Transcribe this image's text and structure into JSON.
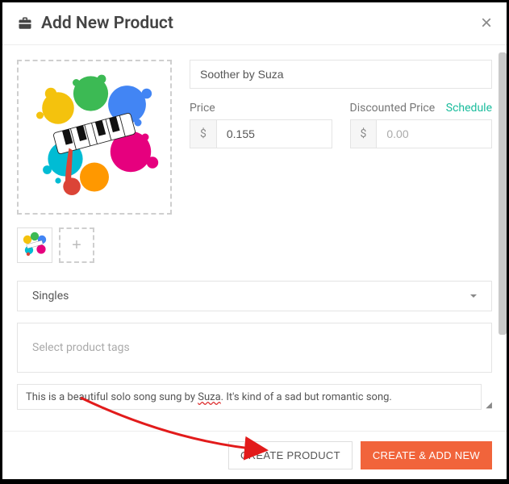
{
  "header": {
    "title": "Add New Product",
    "close": "×"
  },
  "product": {
    "name": "Soother by Suza",
    "price_label": "Price",
    "price_value": "0.155",
    "discount_label": "Discounted Price",
    "discount_placeholder": "0.00",
    "schedule": "Schedule",
    "currency": "$",
    "category": "Singles",
    "tags_placeholder": "Select product tags",
    "description_prefix": "This is a beautiful solo song sung by ",
    "description_highlight": "Suza",
    "description_suffix": ". It's kind of a sad but romantic song."
  },
  "thumb": {
    "add": "+"
  },
  "footer": {
    "create": "CREATE PRODUCT",
    "create_add": "CREATE & ADD NEW"
  }
}
